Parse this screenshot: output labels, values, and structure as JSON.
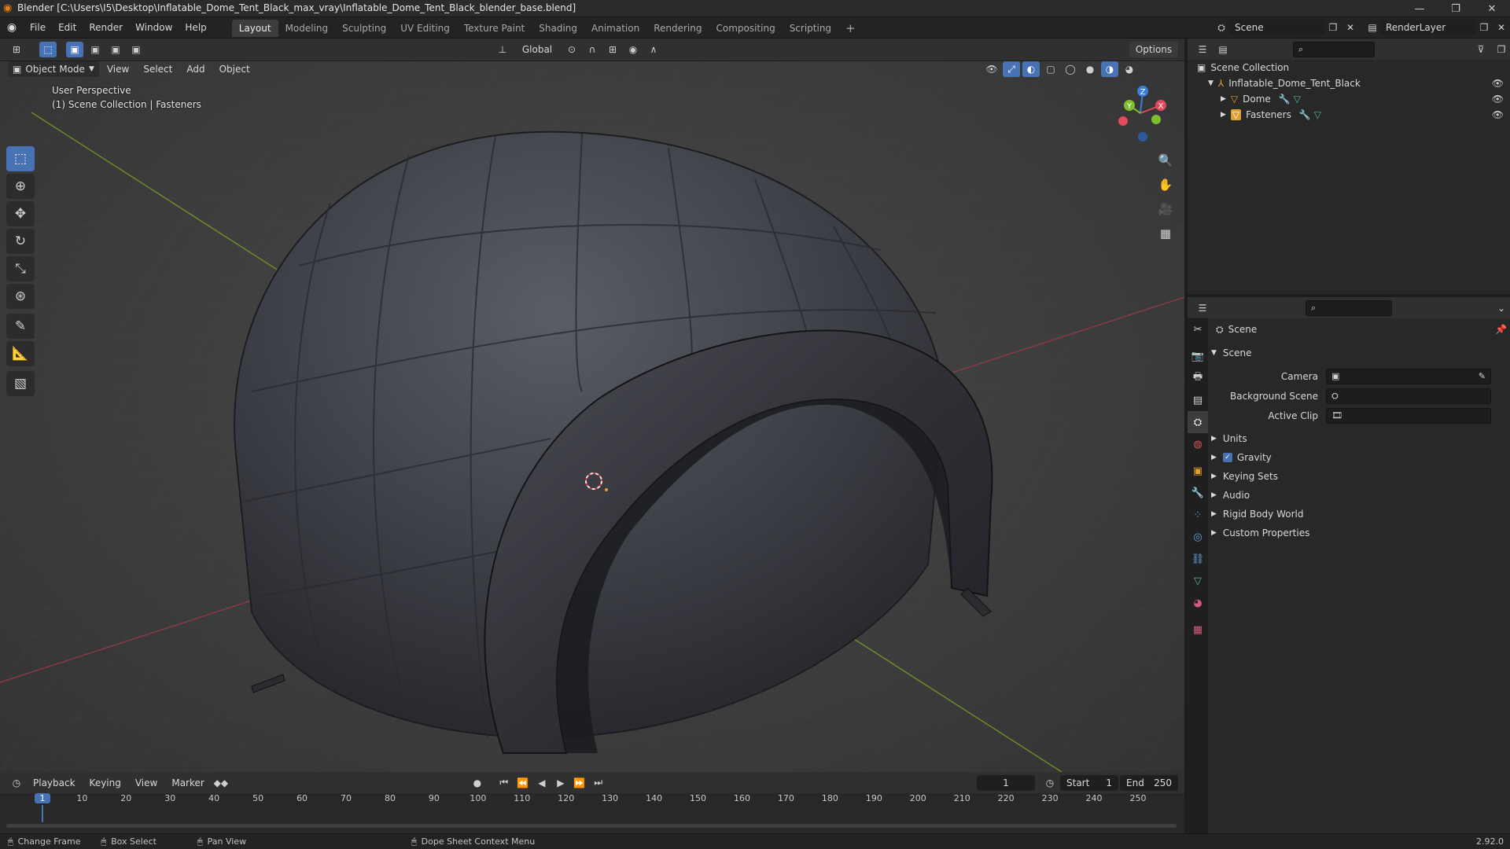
{
  "window": {
    "title": "Blender [C:\\Users\\I5\\Desktop\\Inflatable_Dome_Tent_Black_max_vray\\Inflatable_Dome_Tent_Black_blender_base.blend]"
  },
  "menu": {
    "items": [
      "File",
      "Edit",
      "Render",
      "Window",
      "Help"
    ]
  },
  "workspaces": [
    "Layout",
    "Modeling",
    "Sculpting",
    "UV Editing",
    "Texture Paint",
    "Shading",
    "Animation",
    "Rendering",
    "Compositing",
    "Scripting"
  ],
  "scene_selector": {
    "value": "Scene"
  },
  "renderlayer_selector": {
    "value": "RenderLayer"
  },
  "viewport_header": {
    "mode": "Object Mode",
    "menus": [
      "View",
      "Select",
      "Add",
      "Object"
    ],
    "transform_orientation": "Global",
    "options_label": "Options"
  },
  "viewport_overlay": {
    "line1": "User Perspective",
    "line2": "(1) Scene Collection | Fasteners"
  },
  "gizmo": {
    "x": "X",
    "y": "Y",
    "z": "Z"
  },
  "outliner": {
    "root": "Scene Collection",
    "collection": "Inflatable_Dome_Tent_Black",
    "objects": [
      "Dome",
      "Fasteners"
    ]
  },
  "properties": {
    "header": "Scene",
    "panel": "Scene",
    "fields": [
      {
        "label": "Camera"
      },
      {
        "label": "Background Scene"
      },
      {
        "label": "Active Clip"
      }
    ],
    "sections": [
      "Units",
      "Gravity",
      "Keying Sets",
      "Audio",
      "Rigid Body World",
      "Custom Properties"
    ],
    "gravity_enabled": true
  },
  "timeline": {
    "menus": [
      "Playback",
      "Keying",
      "View",
      "Marker"
    ],
    "current_frame": "1",
    "start_label": "Start",
    "start_value": "1",
    "end_label": "End",
    "end_value": "250",
    "ticks": [
      "1",
      "10",
      "20",
      "30",
      "40",
      "50",
      "60",
      "70",
      "80",
      "90",
      "100",
      "110",
      "120",
      "130",
      "140",
      "150",
      "160",
      "170",
      "180",
      "190",
      "200",
      "210",
      "220",
      "230",
      "240",
      "250"
    ]
  },
  "statusbar": {
    "items": [
      "Change Frame",
      "Box Select",
      "Pan View",
      "Dope Sheet Context Menu"
    ],
    "version": "2.92.0"
  },
  "colors": {
    "accent": "#4772b3",
    "axis_x": "#e04a5a",
    "axis_y": "#7fbf2f",
    "axis_z": "#3a7fd6"
  }
}
